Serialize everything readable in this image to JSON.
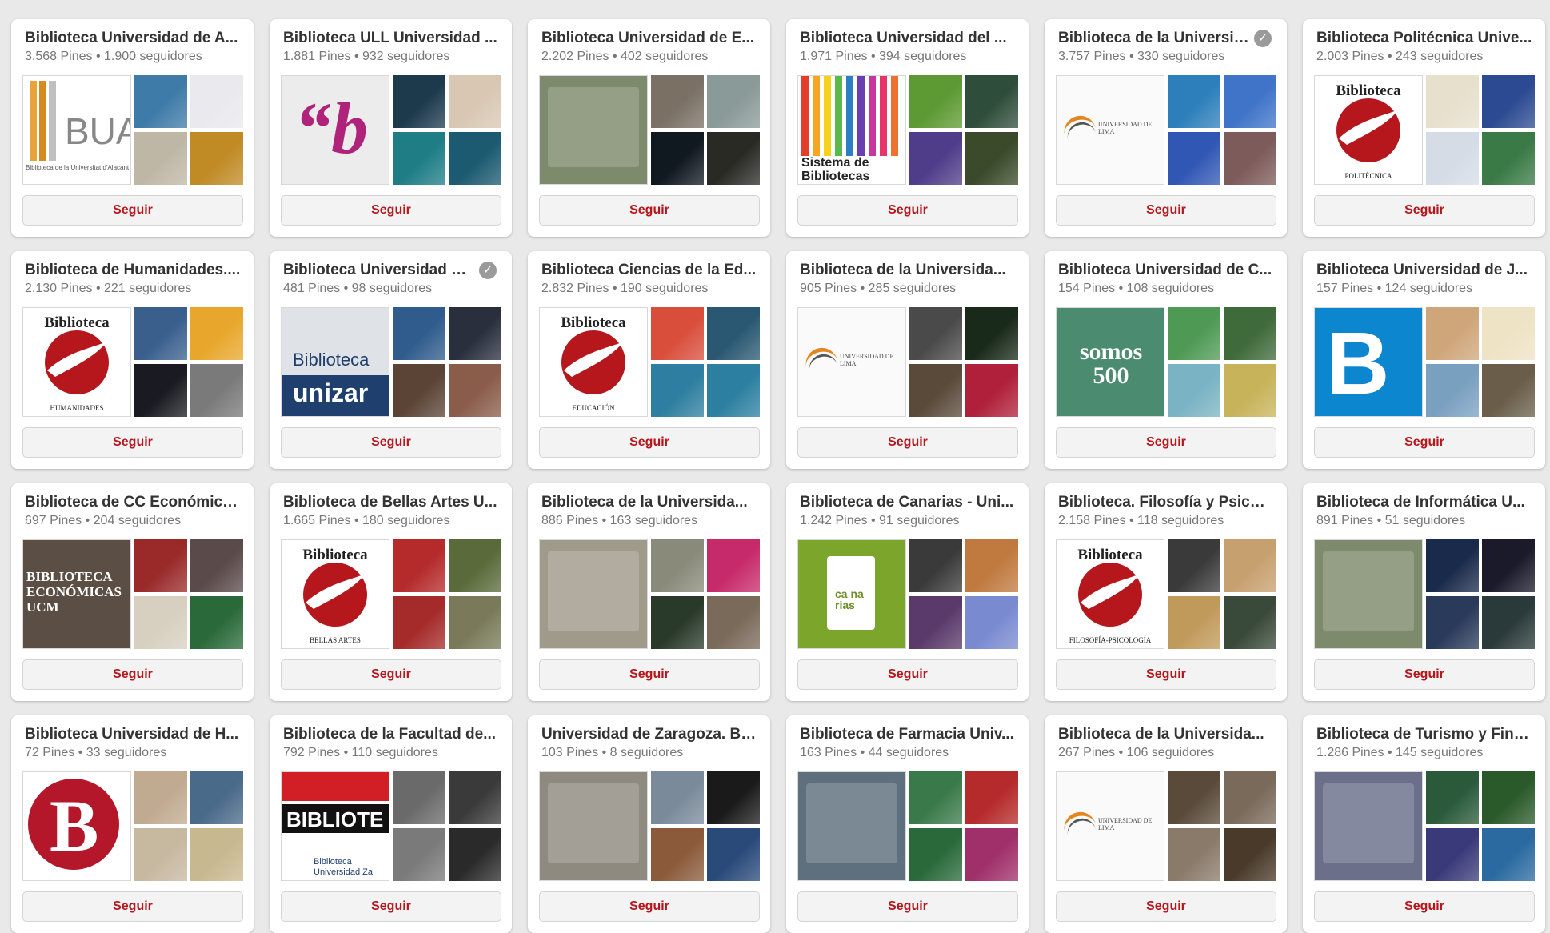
{
  "follow_label": "Seguir",
  "colors": {
    "accent": "#b5171d",
    "seville_red": "#b5171d",
    "card_bg": "#ffffff",
    "page_bg": "#e9e9e9"
  },
  "boards": [
    {
      "title": "Biblioteca Universidad de A...",
      "stats": "3.568 Pines • 1.900 seguidores",
      "logo": "BUA",
      "logo_sub": "Biblioteca de la Universitat d'Alacant",
      "thumb_colors": [
        "#3f7ba8",
        "#e9e9ee",
        "#bfb7a6",
        "#c08a25"
      ]
    },
    {
      "title": "Biblioteca ULL Universidad ...",
      "stats": "1.881 Pines • 932 seguidores",
      "logo": "“b",
      "thumb_colors": [
        "#1d3a4d",
        "#d9c7b3",
        "#1f7d86",
        "#1b5a70"
      ]
    },
    {
      "title": "Biblioteca Universidad de E...",
      "stats": "2.202 Pines • 402 seguidores",
      "logo": "",
      "thumb_colors": [
        "#7a7064",
        "#8a9a98",
        "#101820",
        "#2a2a25"
      ]
    },
    {
      "title": "Biblioteca Universidad del ...",
      "stats": "1.971 Pines • 394 seguidores",
      "logo": "Sistema de Bibliotecas",
      "thumb_colors": [
        "#5e9a33",
        "#2f4d3b",
        "#4f3d8a",
        "#3a4a2a"
      ]
    },
    {
      "title": "Biblioteca de la Universida...",
      "stats": "3.757 Pines • 330 seguidores",
      "logo": "UNIVERSIDAD DE LIMA",
      "verified": true,
      "thumb_colors": [
        "#2d7fbb",
        "#3f74c8",
        "#3157b5",
        "#7d5b5a"
      ]
    },
    {
      "title": "Biblioteca Politécnica Unive...",
      "stats": "2.003 Pines • 243 seguidores",
      "logo": "Biblioteca",
      "logo_sub": "POLITÉCNICA",
      "thumb_colors": [
        "#e7e0cd",
        "#2b4a91",
        "#d5dce6",
        "#3a7a46"
      ]
    },
    {
      "title": "Biblioteca de Humanidades....",
      "stats": "2.130 Pines • 221 seguidores",
      "logo": "Biblioteca",
      "logo_sub": "HUMANIDADES",
      "thumb_colors": [
        "#3a5f8d",
        "#e8a72c",
        "#1a1a22",
        "#7a7a7a"
      ]
    },
    {
      "title": "Biblioteca Universidad de Z...",
      "stats": "481 Pines • 98 seguidores",
      "logo": "Biblioteca unizar",
      "verified": true,
      "thumb_colors": [
        "#2f5c8c",
        "#2a2f3e",
        "#5b4436",
        "#8a5d4b"
      ]
    },
    {
      "title": "Biblioteca Ciencias de la Ed...",
      "stats": "2.832 Pines • 190 seguidores",
      "logo": "Biblioteca",
      "logo_sub": "EDUCACIÓN",
      "thumb_colors": [
        "#d94d3b",
        "#2a5872",
        "#2d7ea0",
        "#2c7fa0"
      ]
    },
    {
      "title": "Biblioteca de la Universida...",
      "stats": "905 Pines • 285 seguidores",
      "logo": "UNIVERSIDAD DE LIMA",
      "thumb_colors": [
        "#4a4a4a",
        "#1a2a1a",
        "#5a4a3a",
        "#b0203a"
      ]
    },
    {
      "title": "Biblioteca Universidad de C...",
      "stats": "154 Pines • 108 seguidores",
      "logo": "somos 500",
      "thumb_colors": [
        "#4e9a55",
        "#3f6a3a",
        "#7ab3c3",
        "#c7b35a"
      ]
    },
    {
      "title": "Biblioteca Universidad de J...",
      "stats": "157 Pines • 124 seguidores",
      "logo": "B",
      "thumb_colors": [
        "#cfa67a",
        "#efe3c5",
        "#7aa0c0",
        "#6a5e4a"
      ]
    },
    {
      "title": "Biblioteca de CC Económica...",
      "stats": "697 Pines • 204 seguidores",
      "logo": "BIBLIOTECA ECONÓMICAS UCM",
      "thumb_colors": [
        "#9a2a2a",
        "#5a4a4a",
        "#d7d0c0",
        "#2a6a3a"
      ]
    },
    {
      "title": "Biblioteca de Bellas Artes U...",
      "stats": "1.665 Pines • 180 seguidores",
      "logo": "Biblioteca",
      "logo_sub": "BELLAS ARTES",
      "thumb_colors": [
        "#b52a2a",
        "#5a6a3a",
        "#a52a2a",
        "#7a7a5a"
      ]
    },
    {
      "title": "Biblioteca de la Universida...",
      "stats": "886 Pines • 163 seguidores",
      "logo": "",
      "thumb_colors": [
        "#8a8a7a",
        "#c72a6a",
        "#2a3a2a",
        "#7a6a5a"
      ]
    },
    {
      "title": "Biblioteca de Canarias - Uni...",
      "stats": "1.242 Pines • 91 seguidores",
      "logo": "ca na rias",
      "thumb_colors": [
        "#3a3a3a",
        "#c07a40",
        "#5a3a6a",
        "#7a8ad0"
      ]
    },
    {
      "title": "Biblioteca. Filosofía y Psicol...",
      "stats": "2.158 Pines • 118 seguidores",
      "logo": "Biblioteca",
      "logo_sub": "FILOSOFÍA-PSICOLOGÍA",
      "thumb_colors": [
        "#3a3a3a",
        "#c7a070",
        "#c09a5a",
        "#3a4a3a"
      ]
    },
    {
      "title": "Biblioteca de Informática U...",
      "stats": "891 Pines • 51 seguidores",
      "logo": "",
      "thumb_colors": [
        "#1a2a4a",
        "#1a1a2a",
        "#2a3a5a",
        "#2a3a3a"
      ]
    },
    {
      "title": "Biblioteca Universidad de H...",
      "stats": "72 Pines • 33 seguidores",
      "logo": "B",
      "thumb_colors": [
        "#c0aa90",
        "#4a6a8a",
        "#c7b8a0",
        "#c8b890"
      ]
    },
    {
      "title": "Biblioteca de la Facultad de...",
      "stats": "792 Pines • 110 seguidores",
      "logo": "BIBLIOTE",
      "logo_sub": "Biblioteca Universidad Za",
      "thumb_colors": [
        "#6a6a6a",
        "#3a3a3a",
        "#7a7a7a",
        "#2a2a2a"
      ]
    },
    {
      "title": "Universidad de Zaragoza. Bi...",
      "stats": "103 Pines • 8 seguidores",
      "logo": "",
      "thumb_colors": [
        "#7a8a9a",
        "#1a1a1a",
        "#8a5a3a",
        "#2a4a7a"
      ]
    },
    {
      "title": "Biblioteca de Farmacia Univ...",
      "stats": "163 Pines • 44 seguidores",
      "logo": "",
      "thumb_colors": [
        "#3a7a4a",
        "#b52a2a",
        "#2a6a3a",
        "#a0306a"
      ]
    },
    {
      "title": "Biblioteca de la Universida...",
      "stats": "267 Pines • 106 seguidores",
      "logo": "UNIVERSIDAD DE LIMA",
      "thumb_colors": [
        "#5a4a3a",
        "#7a6a5a",
        "#8a7a6a",
        "#4a3a2a"
      ]
    },
    {
      "title": "Biblioteca de Turismo y Fina...",
      "stats": "1.286 Pines • 145 seguidores",
      "logo": "",
      "thumb_colors": [
        "#2a5a3a",
        "#2a5a2a",
        "#3a3a7a",
        "#2a6aa0"
      ]
    }
  ]
}
